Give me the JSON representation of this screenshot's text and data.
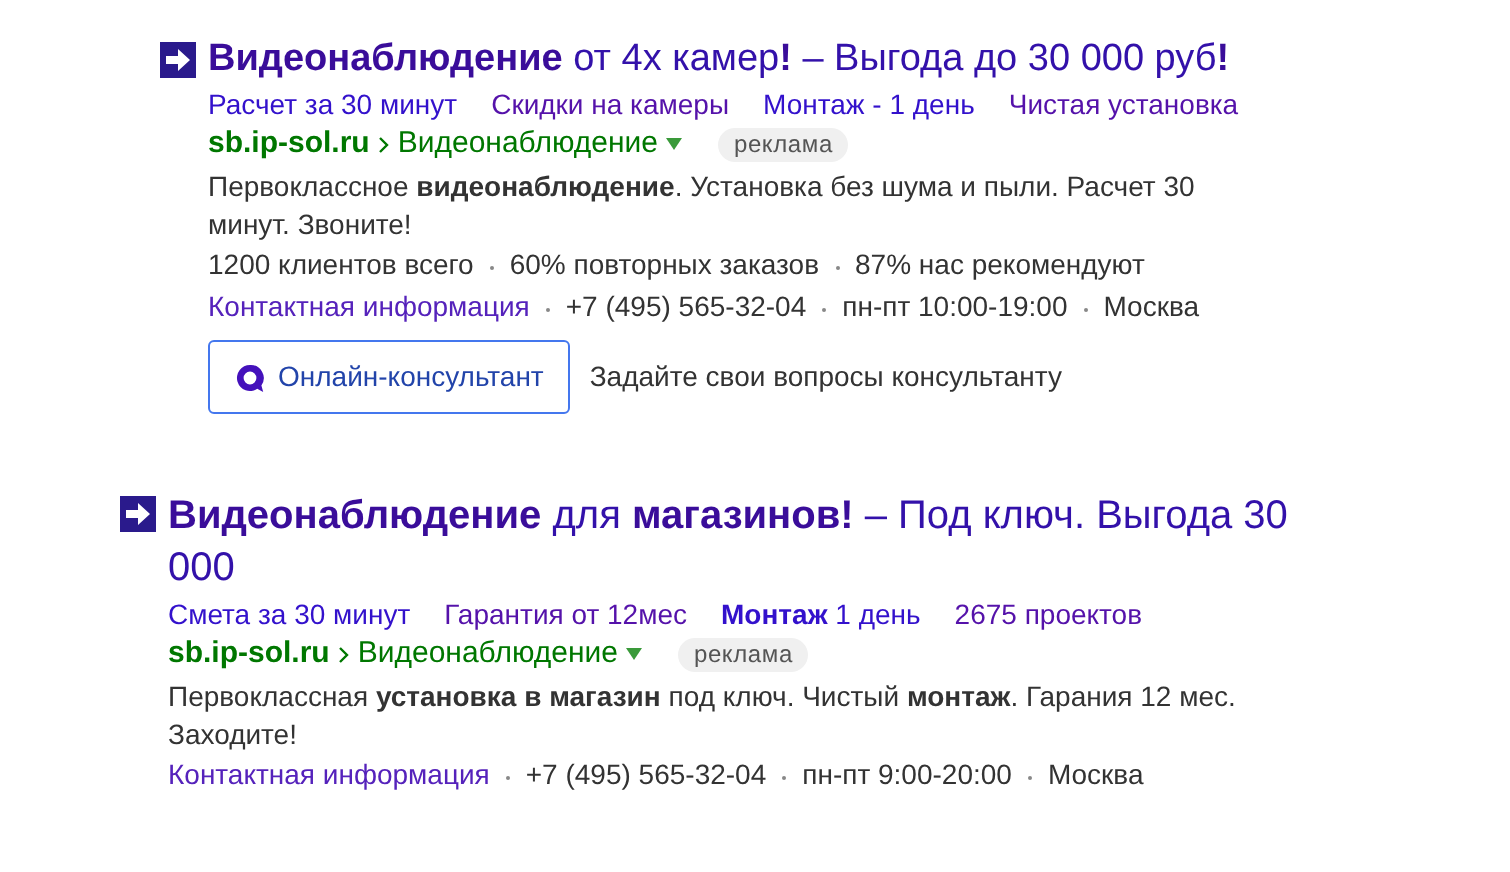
{
  "ads": [
    {
      "title": "**Видеонаблюдение** от 4х камер**!** – Выгода до 30 000 руб**!**",
      "sitelinks": [
        "Расчет за 30 минут",
        "Скидки на камеры",
        "Монтаж - 1 день",
        "Чистая установка"
      ],
      "url": {
        "domain": "sb.ip-sol.ru",
        "path": "Видеонаблюдение"
      },
      "label": "реклама",
      "description": "Первоклассное **видеонаблюдение**. Установка без шума и пыли. Расчет 30 минут. Звоните!",
      "stats": [
        "1200 клиентов всего",
        "60% повторных заказов",
        "87% нас рекомендуют"
      ],
      "contacts": {
        "link": "Контактная информация",
        "items": [
          "+7 (495) 565-32-04",
          "пн-пт 10:00-19:00",
          "Москва"
        ]
      },
      "chat": {
        "button": "Онлайн-консультант",
        "text": "Задайте свои вопросы консультанту"
      }
    },
    {
      "title": "**Видеонаблюдение** для **магазинов!** – Под ключ. Выгода 30 000",
      "sitelinks": [
        "Смета за 30 минут",
        "Гарантия от 12мес",
        "**Монтаж** 1 день",
        "2675 проектов"
      ],
      "url": {
        "domain": "sb.ip-sol.ru",
        "path": "Видеонаблюдение"
      },
      "label": "реклама",
      "description": "Первоклассная **установка в магазин** под ключ. Чистый **монтаж**. Гарания 12 мес. Заходите!",
      "contacts": {
        "link": "Контактная информация",
        "items": [
          "+7 (495) 565-32-04",
          "пн-пт 9:00-20:00",
          "Москва"
        ]
      }
    }
  ]
}
